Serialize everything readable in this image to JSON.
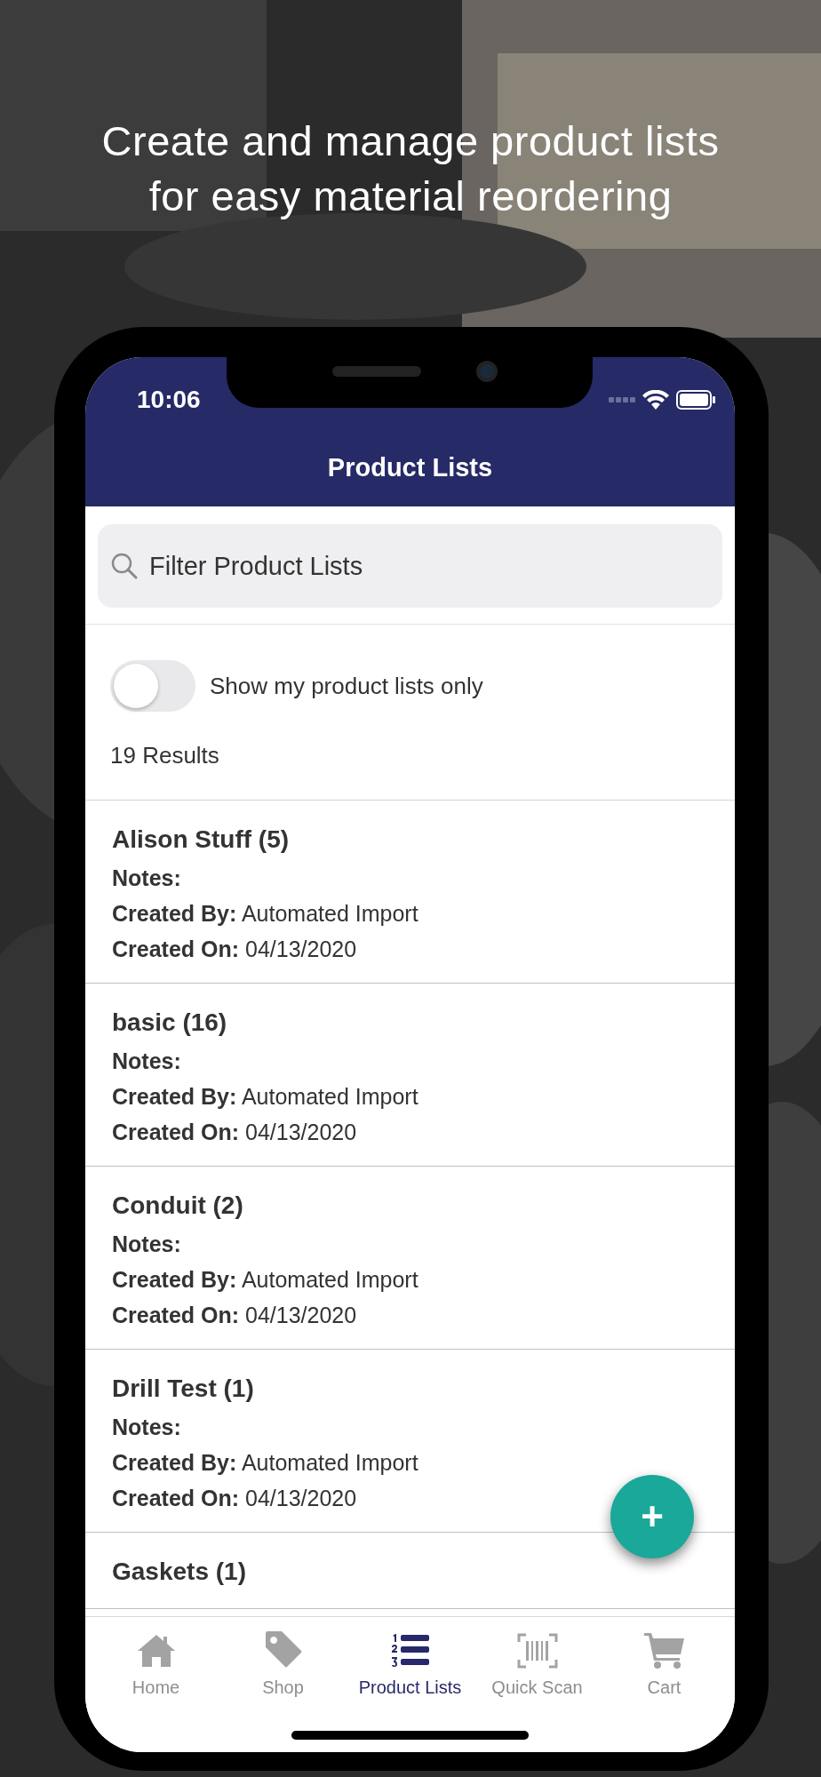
{
  "headline": "Create and manage product lists\nfor easy material reordering",
  "status_bar": {
    "time": "10:06"
  },
  "header": {
    "title": "Product Lists"
  },
  "search": {
    "placeholder": "Filter Product Lists"
  },
  "toggle": {
    "label": "Show my product lists only",
    "on": false
  },
  "results": "19 Results",
  "lists": [
    {
      "name": "Alison Stuff (5)",
      "notes_label": "Notes:",
      "created_by": "**Created By:** Automated Import",
      "created_on": "**Created On:** 04/13/2020"
    },
    {
      "name": "basic (16)",
      "notes_label": "Notes:",
      "created_by": "**Created By:** Automated Import",
      "created_on": "**Created On:** 04/13/2020"
    },
    {
      "name": "Conduit (2)",
      "notes_label": "Notes:",
      "created_by": "**Created By:** Automated Import",
      "created_on": "**Created On:** 04/13/2020"
    },
    {
      "name": "Drill Test (1)",
      "notes_label": "Notes:",
      "created_by": "**Created By:** Automated Import",
      "created_on": "**Created On:** 04/13/2020"
    },
    {
      "name": "Gaskets (1)"
    }
  ],
  "fab": "+",
  "tabs": [
    {
      "label": "Home",
      "kind": "home",
      "selected": false
    },
    {
      "label": "Shop",
      "kind": "tag",
      "selected": false
    },
    {
      "label": "Product Lists",
      "kind": "list",
      "selected": true
    },
    {
      "label": "Quick Scan",
      "kind": "scan",
      "selected": false
    },
    {
      "label": "Cart",
      "kind": "cart",
      "selected": false
    }
  ]
}
